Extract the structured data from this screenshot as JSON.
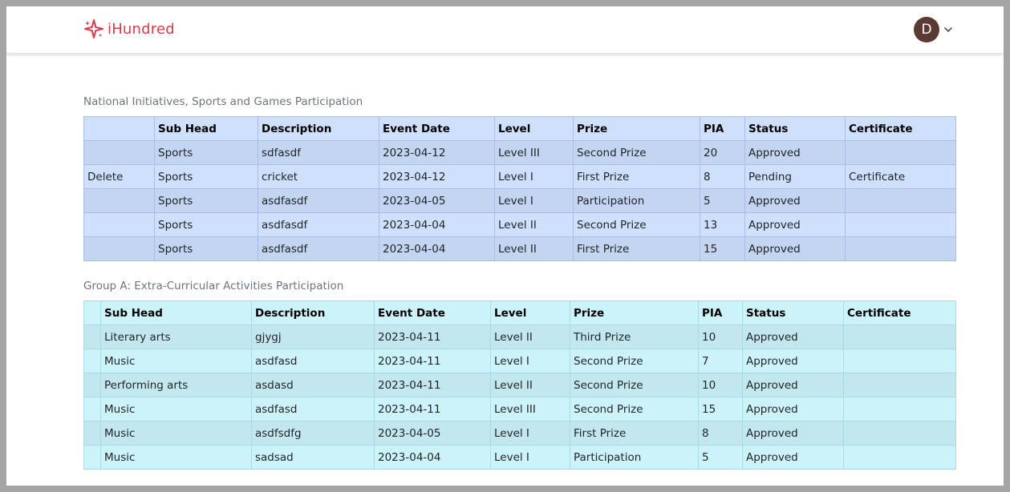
{
  "app": {
    "name": "iHundred",
    "brand_color": "#d83b4a"
  },
  "user": {
    "initial": "D",
    "avatar_color": "#5b3a33"
  },
  "section1": {
    "title": "National Initiatives, Sports and Games Participation",
    "headers": [
      "",
      "Sub Head",
      "Description",
      "Event Date",
      "Level",
      "Prize",
      "PIA",
      "Status",
      "Certificate"
    ],
    "rows": [
      [
        "",
        "Sports",
        "sdfasdf",
        "2023-04-12",
        "Level III",
        "Second Prize",
        "20",
        "Approved",
        ""
      ],
      [
        "Delete",
        "Sports",
        "cricket",
        "2023-04-12",
        "Level I",
        "First Prize",
        "8",
        "Pending",
        "Certificate"
      ],
      [
        "",
        "Sports",
        "asdfasdf",
        "2023-04-05",
        "Level I",
        "Participation",
        "5",
        "Approved",
        ""
      ],
      [
        "",
        "Sports",
        "asdfasdf",
        "2023-04-04",
        "Level II",
        "Second Prize",
        "13",
        "Approved",
        ""
      ],
      [
        "",
        "Sports",
        "asdfasdf",
        "2023-04-04",
        "Level II",
        "First Prize",
        "15",
        "Approved",
        ""
      ]
    ]
  },
  "section2": {
    "title": "Group A: Extra-Curricular Activities Participation",
    "headers": [
      "",
      "Sub Head",
      "Description",
      "Event Date",
      "Level",
      "Prize",
      "PIA",
      "Status",
      "Certificate"
    ],
    "rows": [
      [
        "",
        "Literary arts",
        "gjygj",
        "2023-04-11",
        "Level II",
        "Third Prize",
        "10",
        "Approved",
        ""
      ],
      [
        "",
        "Music",
        "asdfasd",
        "2023-04-11",
        "Level I",
        "Second Prize",
        "7",
        "Approved",
        ""
      ],
      [
        "",
        "Performing arts",
        "asdasd",
        "2023-04-11",
        "Level II",
        "Second Prize",
        "10",
        "Approved",
        ""
      ],
      [
        "",
        "Music",
        "asdfasd",
        "2023-04-11",
        "Level III",
        "Second Prize",
        "15",
        "Approved",
        ""
      ],
      [
        "",
        "Music",
        "asdfsdfg",
        "2023-04-05",
        "Level I",
        "First Prize",
        "8",
        "Approved",
        ""
      ],
      [
        "",
        "Music",
        "sadsad",
        "2023-04-04",
        "Level I",
        "Participation",
        "5",
        "Approved",
        ""
      ]
    ]
  }
}
